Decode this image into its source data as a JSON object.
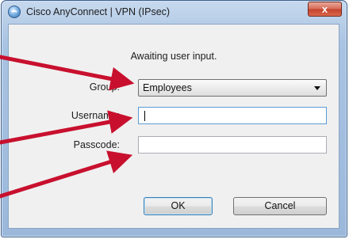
{
  "window": {
    "title": "Cisco AnyConnect | VPN (IPsec)",
    "close_symbol": "x"
  },
  "dialog": {
    "status": "Awaiting user input.",
    "group_label": "Group:",
    "group_value": "Employees",
    "username_label": "Username:",
    "username_value": "",
    "passcode_label": "Passcode:",
    "passcode_value": ""
  },
  "buttons": {
    "ok": "OK",
    "cancel": "Cancel"
  },
  "colors": {
    "annotation_arrow": "#c8102e",
    "close_button": "#c5432c"
  }
}
